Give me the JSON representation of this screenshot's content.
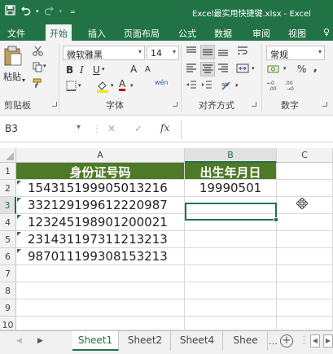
{
  "window": {
    "title": "Excel最实用快捷键.xlsx - Excel"
  },
  "qat": {
    "save_icon": "save-icon",
    "undo_icon": "undo-icon",
    "redo_icon": "redo-icon",
    "customize_icon": "customize-icon"
  },
  "tabs": [
    {
      "label": "文件"
    },
    {
      "label": "开始"
    },
    {
      "label": "插入"
    },
    {
      "label": "页面布局"
    },
    {
      "label": "公式"
    },
    {
      "label": "数据"
    },
    {
      "label": "审阅"
    },
    {
      "label": "视图"
    },
    {
      "label": "♀"
    }
  ],
  "ribbon": {
    "clipboard": {
      "paste_label": "粘贴",
      "group_label": "剪贴板"
    },
    "font": {
      "font_name": "微软雅黑",
      "font_size": "14",
      "bold": "B",
      "italic": "I",
      "underline": "U",
      "group_label": "字体",
      "grow": "A",
      "shrink": "A",
      "wen": "wén"
    },
    "alignment": {
      "group_label": "对齐方式"
    },
    "number": {
      "format": "常规",
      "group_label": "数字",
      "percent": "%",
      "comma": ","
    }
  },
  "formula_bar": {
    "name_box": "B3",
    "cancel": "✕",
    "enter": "✓",
    "fx": "fx",
    "value": ""
  },
  "columns": [
    {
      "label": "A"
    },
    {
      "label": "B"
    },
    {
      "label": "C"
    }
  ],
  "rows": [
    "1",
    "2",
    "3",
    "4",
    "5",
    "6",
    "7",
    "8",
    "9",
    "10"
  ],
  "cells": {
    "A1": "身份证号码",
    "B1": "出生年月日",
    "A2": "154315199905013216",
    "B2": "19990501",
    "A3": "332129199612220987",
    "A4": "123245198901200021",
    "A5": "231431197311213213",
    "A6": "987011199308153213"
  },
  "sheets": [
    {
      "label": "Sheet1",
      "active": true
    },
    {
      "label": "Sheet2"
    },
    {
      "label": "Sheet4"
    },
    {
      "label": "Shee"
    }
  ],
  "colors": {
    "accent": "#217346",
    "header_fill": "#4e7a28"
  }
}
